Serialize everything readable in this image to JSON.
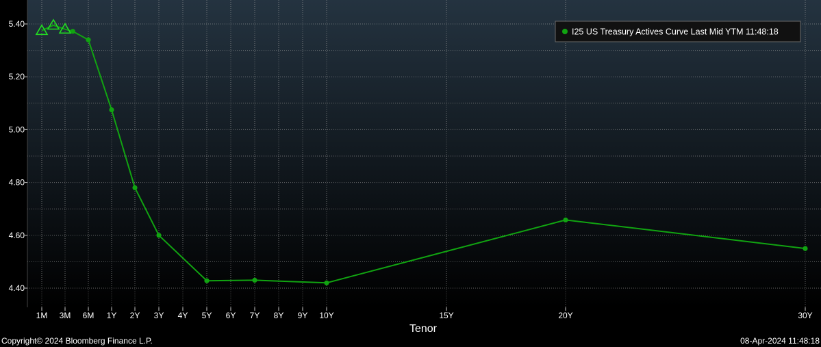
{
  "chart_data": {
    "type": "line",
    "xlabel": "Tenor",
    "ylabel": "",
    "ylim": [
      4.35,
      5.48
    ],
    "grid": true,
    "legend_position": "top-right",
    "legend": "I25 US Treasury Actives Curve Last Mid YTM 11:48:18",
    "y_ticks": [
      4.4,
      4.6,
      4.8,
      5.0,
      5.2,
      5.4
    ],
    "y_tick_labels": [
      "4.40",
      "4.60",
      "4.80",
      "5.00",
      "5.20",
      "5.40"
    ],
    "x_ticks": [
      {
        "label": "1M",
        "tenor_years": 0.0833
      },
      {
        "label": "3M",
        "tenor_years": 0.25
      },
      {
        "label": "6M",
        "tenor_years": 0.5
      },
      {
        "label": "1Y",
        "tenor_years": 1
      },
      {
        "label": "2Y",
        "tenor_years": 2
      },
      {
        "label": "3Y",
        "tenor_years": 3
      },
      {
        "label": "4Y",
        "tenor_years": 4
      },
      {
        "label": "5Y",
        "tenor_years": 5
      },
      {
        "label": "6Y",
        "tenor_years": 6
      },
      {
        "label": "7Y",
        "tenor_years": 7
      },
      {
        "label": "8Y",
        "tenor_years": 8
      },
      {
        "label": "9Y",
        "tenor_years": 9
      },
      {
        "label": "10Y",
        "tenor_years": 10
      },
      {
        "label": "15Y",
        "tenor_years": 15
      },
      {
        "label": "20Y",
        "tenor_years": 20
      },
      {
        "label": "30Y",
        "tenor_years": 30
      }
    ],
    "series": [
      {
        "color": "#11a411",
        "points": [
          {
            "tenor": "1M",
            "tenor_years": 0.0833,
            "value": 5.375,
            "marker": "triangle"
          },
          {
            "tenor": "2M",
            "tenor_years": 0.1667,
            "value": 5.395,
            "marker": "triangle"
          },
          {
            "tenor": "3M",
            "tenor_years": 0.25,
            "value": 5.38,
            "marker": "triangle"
          },
          {
            "tenor": "4M",
            "tenor_years": 0.333,
            "value": 5.372,
            "marker": "circle"
          },
          {
            "tenor": "6M",
            "tenor_years": 0.5,
            "value": 5.34,
            "marker": "circle"
          },
          {
            "tenor": "1Y",
            "tenor_years": 1,
            "value": 5.075,
            "marker": "circle"
          },
          {
            "tenor": "2Y",
            "tenor_years": 2,
            "value": 4.78,
            "marker": "circle"
          },
          {
            "tenor": "3Y",
            "tenor_years": 3,
            "value": 4.6,
            "marker": "circle"
          },
          {
            "tenor": "5Y",
            "tenor_years": 5,
            "value": 4.428,
            "marker": "circle"
          },
          {
            "tenor": "7Y",
            "tenor_years": 7,
            "value": 4.43,
            "marker": "circle"
          },
          {
            "tenor": "10Y",
            "tenor_years": 10,
            "value": 4.42,
            "marker": "circle"
          },
          {
            "tenor": "20Y",
            "tenor_years": 20,
            "value": 4.658,
            "marker": "circle"
          },
          {
            "tenor": "30Y",
            "tenor_years": 30,
            "value": 4.55,
            "marker": "circle"
          }
        ]
      }
    ]
  },
  "colors": {
    "background_top": "#243340",
    "background_bottom": "#000000",
    "series": "#11a411",
    "grid": "#9a9a9a",
    "legend_border": "#6a6a6a",
    "legend_bg": "#111111",
    "text": "#ffffff"
  },
  "footer": {
    "copyright": "Copyright© 2024 Bloomberg Finance L.P.",
    "timestamp": "08-Apr-2024 11:48:18"
  }
}
